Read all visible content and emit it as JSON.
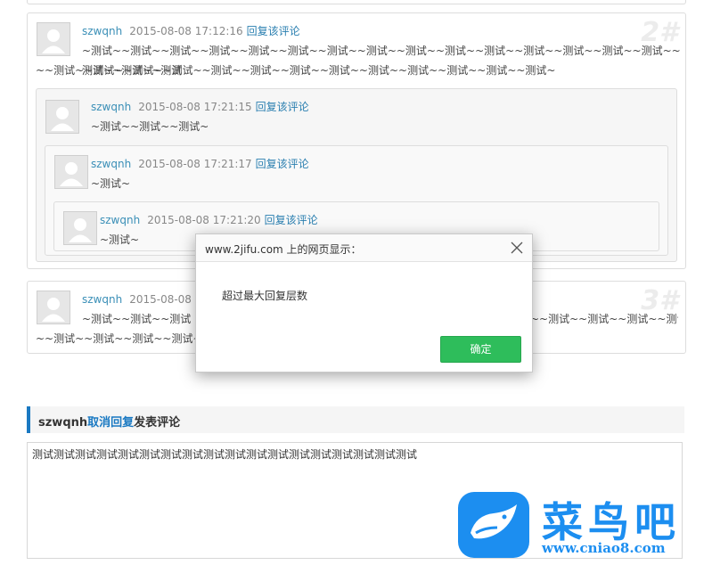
{
  "comments": {
    "c2": {
      "floor": "2#",
      "user": "szwqnh",
      "time": "2015-08-08 17:12:16",
      "reply": "回复该评论",
      "line1": "~测试~~测试~~测试~~测试~~测试~~测试~~测试~~测试~~测试~~测试~~测试~~测试~~测试~~测试~~测试~~测试~~测试~~测试",
      "line2": "~~测试~~测试~~测试~~测试~~测试~~测试~~测试~~测试~~测试~~测试~~测试~~测试~~测试~"
    },
    "c2a": {
      "user": "szwqnh",
      "time": "2015-08-08 17:21:15",
      "reply": "回复该评论",
      "text": "~测试~~测试~~测试~"
    },
    "c2b": {
      "user": "szwqnh",
      "time": "2015-08-08 17:21:17",
      "reply": "回复该评论",
      "text": "~测试~"
    },
    "c2c": {
      "user": "szwqnh",
      "time": "2015-08-08 17:21:20",
      "reply": "回复该评论",
      "text": "~测试~"
    },
    "c3": {
      "floor": "3#",
      "user": "szwqnh",
      "time": "2015-08-08 1",
      "line1_left": "~测试~~测试~~测试",
      "line1_right": "~~测试~~测试~~测试~~测试~~测试~~测试",
      "line2": "~~测试~~测试~~测试~~测试~~测试"
    }
  },
  "form": {
    "user": "szwqnh",
    "cancel": "取消回复",
    "title": "发表评论",
    "content": "测试测试测试测试测试测试测试测试测试测试测试测试测试测试测试测试测试测试"
  },
  "dialog": {
    "title": "www.2jifu.com 上的网页显示：",
    "message": "超过最大回复层数",
    "ok": "确定"
  },
  "watermark": {
    "name": "菜鸟吧",
    "url": "www.cniao8.com"
  },
  "colors": {
    "link": "#3a8fb7",
    "accent": "#1a79c2",
    "ok_button": "#2ebd5b",
    "watermark": "#1c8ef0"
  }
}
